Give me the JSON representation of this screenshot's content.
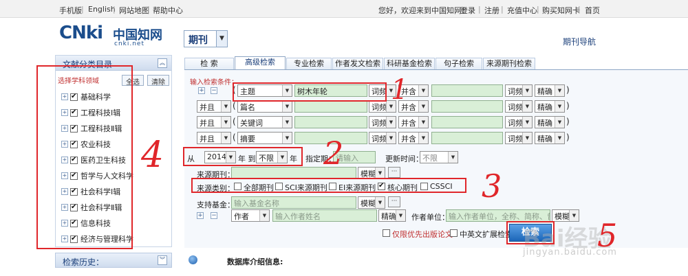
{
  "topbar": {
    "left_links": [
      "手机版",
      "English",
      "网站地图",
      "帮助中心"
    ],
    "welcome": "您好，欢迎来到中国知网！",
    "right_links": [
      "登录",
      "注册",
      "充值中心",
      "购买知网卡",
      "首页"
    ]
  },
  "header": {
    "logo_main": "CNki",
    "logo_cn": "中国知网",
    "logo_sub": "cnki.net",
    "db_select": "期刊",
    "nav_right": "期刊导航"
  },
  "sidebar": {
    "title": "文献分类目录",
    "subtitle": "选择学科领域",
    "select_all": "全选",
    "clear": "清除",
    "categories": [
      {
        "label": "基础科学",
        "checked": true
      },
      {
        "label": "工程科技Ⅰ辑",
        "checked": true
      },
      {
        "label": "工程科技Ⅱ辑",
        "checked": true
      },
      {
        "label": "农业科技",
        "checked": true
      },
      {
        "label": "医药卫生科技",
        "checked": true
      },
      {
        "label": "哲学与人文科学",
        "checked": true
      },
      {
        "label": "社会科学Ⅰ辑",
        "checked": true
      },
      {
        "label": "社会科学Ⅱ辑",
        "checked": true
      },
      {
        "label": "信息科技",
        "checked": true
      },
      {
        "label": "经济与管理科学",
        "checked": true
      }
    ],
    "history": "检索历史："
  },
  "tabs": [
    {
      "label": "检 索",
      "active": false
    },
    {
      "label": "高级检索",
      "active": true
    },
    {
      "label": "专业检索",
      "active": false
    },
    {
      "label": "作者发文检索",
      "active": false
    },
    {
      "label": "科研基金检索",
      "active": false
    },
    {
      "label": "句子检索",
      "active": false
    },
    {
      "label": "来源期刊检索",
      "active": false
    }
  ],
  "form": {
    "condition_label": "输入检索条件：",
    "rows": [
      {
        "logic": "",
        "field": "主题",
        "value": "树木年轮",
        "freq": "词频",
        "combine": "并含",
        "freq2": "词频",
        "match": "精确"
      },
      {
        "logic": "并且",
        "field": "篇名",
        "value": "",
        "freq": "词频",
        "combine": "并含",
        "freq2": "词频",
        "match": "精确"
      },
      {
        "logic": "并且",
        "field": "关键词",
        "value": "",
        "freq": "词频",
        "combine": "并含",
        "freq2": "词频",
        "match": "精确"
      },
      {
        "logic": "并且",
        "field": "摘要",
        "value": "",
        "freq": "词频",
        "combine": "并含",
        "freq2": "词频",
        "match": "精确"
      }
    ],
    "year_from_label": "从",
    "year_from": "2014",
    "year_to_label": "年 到",
    "year_to": "不限",
    "year_suffix": "年",
    "period_label": "指定期：",
    "period_placeholder": "请输入",
    "update_label": "更新时间：",
    "update_value": "不限",
    "source_label": "来源期刊：",
    "source_match": "模糊",
    "category_label": "来源类别：",
    "source_types": [
      {
        "label": "全部期刊",
        "checked": false
      },
      {
        "label": "SCI来源期刊",
        "checked": false
      },
      {
        "label": "EI来源期刊",
        "checked": false
      },
      {
        "label": "核心期刊",
        "checked": true
      },
      {
        "label": "CSSCI",
        "checked": false
      }
    ],
    "fund_label": "支持基金：",
    "fund_placeholder": "输入基金名称",
    "fund_match": "模糊",
    "author_field": "作者",
    "author_placeholder": "输入作者姓名",
    "author_match": "精确",
    "affil_label": "作者单位：",
    "affil_placeholder": "输入作者单位，全称、简称、曾用名均可",
    "affil_match": "模糊",
    "only_first": "仅限优先出版论文",
    "bilingual": "中英文扩展检索",
    "search_button": "检索"
  },
  "footer": {
    "db_intro": "数据库介绍信息:"
  },
  "annotations": [
    "1",
    "2",
    "3",
    "4",
    "5"
  ],
  "watermark": {
    "main": "Bai经验",
    "sub": "jingyan.baidu.com"
  },
  "colors": {
    "accent": "#1b3f7a",
    "annotation": "#e0262a",
    "input_bg": "#d9efd7"
  }
}
